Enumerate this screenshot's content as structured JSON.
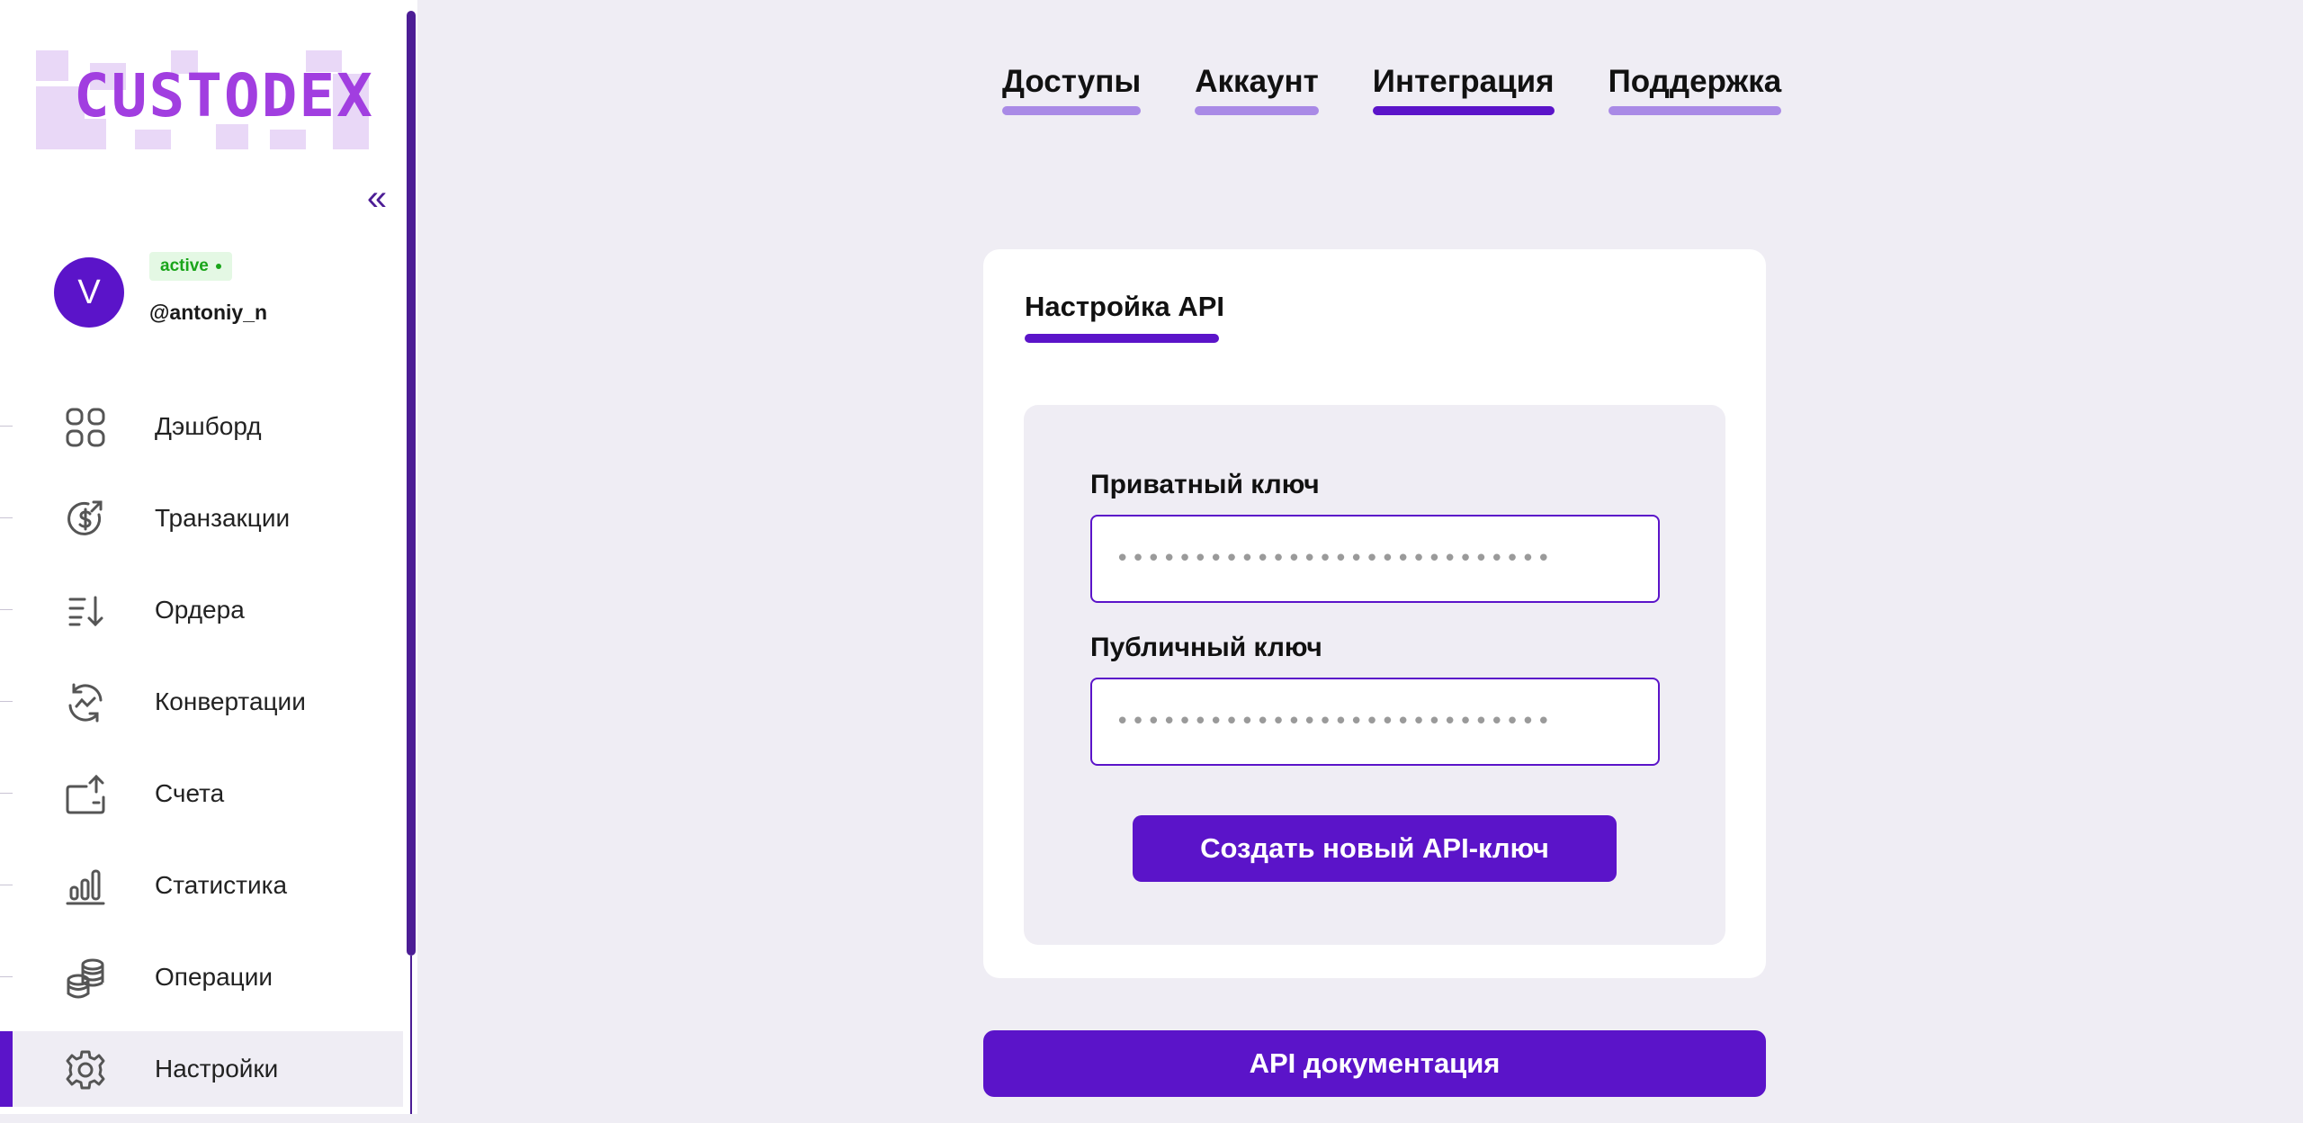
{
  "brand": {
    "logo_text": "CUSTODEX"
  },
  "sidebar": {
    "collapse_glyph": "«",
    "profile": {
      "avatar_letter": "V",
      "status": "active",
      "username": "@antoniy_n"
    },
    "items": [
      {
        "label": "Дэшборд",
        "icon": "dashboard-grid-icon"
      },
      {
        "label": "Транзакции",
        "icon": "dollar-refresh-icon"
      },
      {
        "label": "Ордера",
        "icon": "sort-list-icon"
      },
      {
        "label": "Конвертации",
        "icon": "conversion-cycle-icon"
      },
      {
        "label": "Счета",
        "icon": "wallet-upload-icon"
      },
      {
        "label": "Статистика",
        "icon": "bar-stats-icon"
      },
      {
        "label": "Операции",
        "icon": "coin-stack-icon"
      },
      {
        "label": "Настройки",
        "icon": "gear-icon",
        "active": true
      }
    ]
  },
  "tabs": [
    {
      "label": "Доступы"
    },
    {
      "label": "Аккаунт"
    },
    {
      "label": "Интеграция",
      "active": true
    },
    {
      "label": "Поддержка"
    }
  ],
  "api": {
    "section_tab": "Настройка API",
    "private_key": {
      "label": "Приватный ключ",
      "value": "••••••••••••••••••••••••••••"
    },
    "public_key": {
      "label": "Публичный ключ",
      "value": "••••••••••••••••••••••••••••"
    },
    "create_button": "Создать новый API-ключ",
    "docs_button": "API документация"
  },
  "colors": {
    "accent": "#5b14c9",
    "accent_light": "#a98ae6",
    "background": "#efedf4",
    "status_green": "#1aa51a",
    "logo": "#a13ee0"
  }
}
